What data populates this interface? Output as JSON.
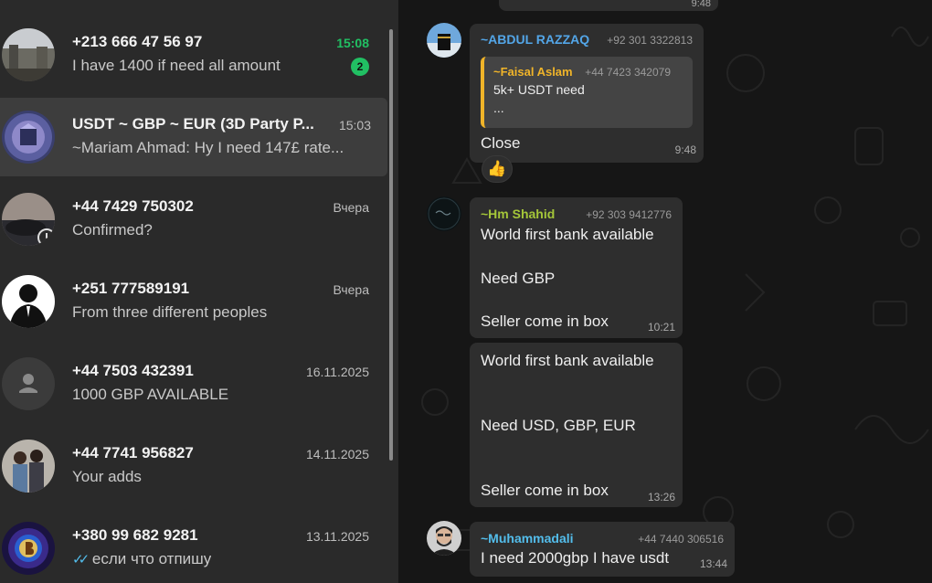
{
  "chat_list": [
    {
      "name": "+213 666 47 56 97",
      "preview": "I have 1400 if need all amount",
      "time": "15:08",
      "unread": "2"
    },
    {
      "name": "USDT ~ GBP ~ EUR (3D Party P...",
      "preview": "~Mariam Ahmad: Hy I need 147£ rate...",
      "time": "15:03"
    },
    {
      "name": "+44 7429 750302",
      "preview": "Confirmed?",
      "time": "Вчера"
    },
    {
      "name": "+251 777589191",
      "preview": "From three different peoples",
      "time": "Вчера"
    },
    {
      "name": "+44 7503 432391",
      "preview": "1000 GBP AVAILABLE",
      "time": "16.11.2025"
    },
    {
      "name": "+44 7741 956827",
      "preview": "Your adds",
      "time": "14.11.2025"
    },
    {
      "name": "+380 99 682 9281",
      "preview": "если что отпишу",
      "time": "13.11.2025",
      "status_icon": "double-check-icon"
    }
  ],
  "messages": [
    {
      "sender": "~ABDUL RAZZAQ",
      "phone": "+92 301 3322813",
      "quote": {
        "sender": "~Faisal Aslam",
        "phone": "+44 7423 342079",
        "lines": [
          "5k+ USDT need",
          "..."
        ]
      },
      "text": "Close",
      "time": "9:48",
      "reaction": "👍"
    },
    {
      "sender": "~Hm Shahid",
      "phone": "+92 303 9412776",
      "lines": [
        "World first bank available",
        "Need GBP",
        "Seller come in box"
      ],
      "time": "10:21"
    },
    {
      "lines": [
        "World first bank available",
        "Need USD, GBP, EUR",
        "Seller come in box"
      ],
      "time": "13:26"
    },
    {
      "sender": "~Muhammadali",
      "phone": "+44 7440 306516",
      "text": "I need 2000gbp I have usdt",
      "time": "13:44"
    }
  ],
  "top_cut_time": "9:48",
  "colors": {
    "unread_green": "#21c063",
    "sender_abdul": "#53a6e8",
    "sender_faisal": "#f0b429",
    "sender_shahid": "#a4c639",
    "sender_muhammadali": "#53bdeb",
    "read_ticks": "#53bdeb"
  }
}
